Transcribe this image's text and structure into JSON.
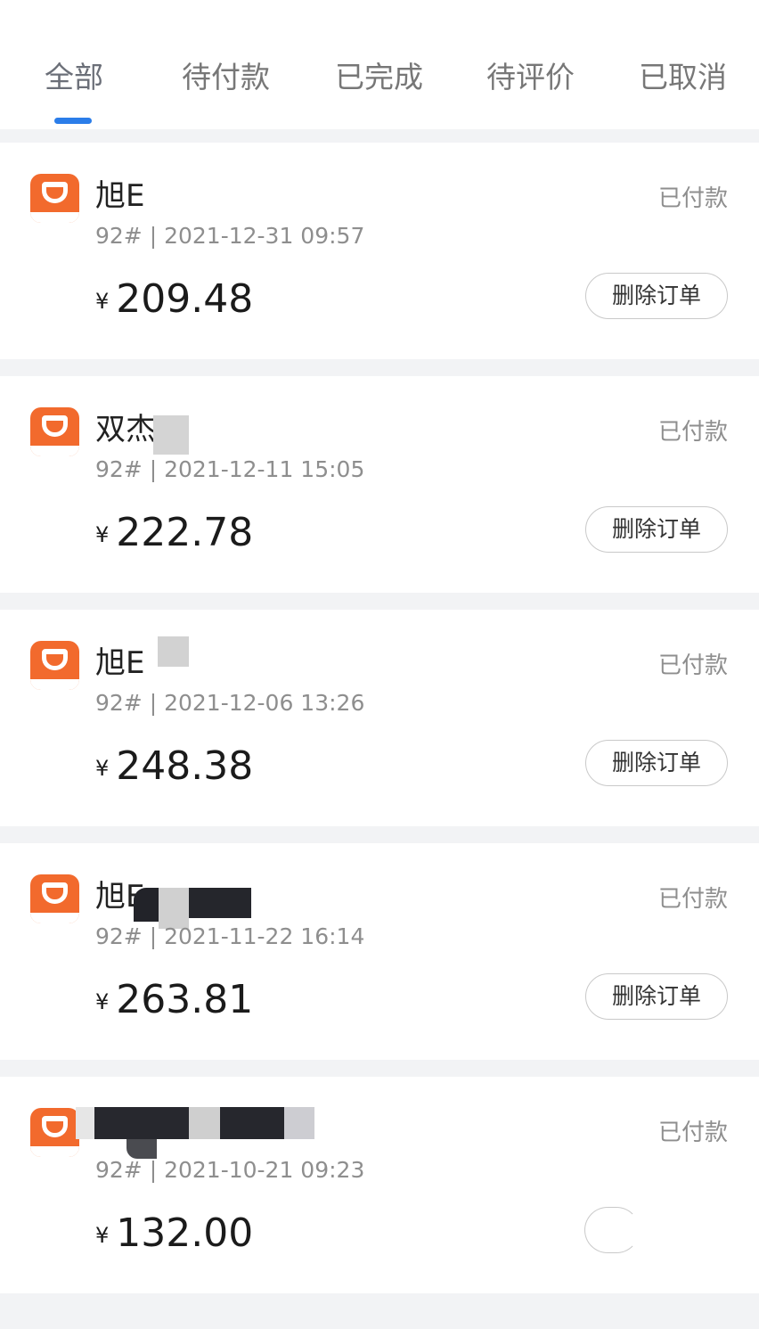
{
  "tabs": [
    "全部",
    "待付款",
    "已完成",
    "待评价",
    "已取消"
  ],
  "active_tab": "全部",
  "orders": [
    {
      "merchant": "旭E",
      "meta": "92# | 2021-12-31 09:57",
      "status": "已付款",
      "currency": "¥",
      "amount": "209.48",
      "action": "删除订单"
    },
    {
      "merchant": "双杰",
      "meta": "92# | 2021-12-11 15:05",
      "status": "已付款",
      "currency": "¥",
      "amount": "222.78",
      "action": "删除订单"
    },
    {
      "merchant": "旭E",
      "meta": "92# | 2021-12-06 13:26",
      "status": "已付款",
      "currency": "¥",
      "amount": "248.38",
      "action": "删除订单"
    },
    {
      "merchant": "旭E",
      "meta": "92# | 2021-11-22 16:14",
      "status": "已付款",
      "currency": "¥",
      "amount": "263.81",
      "action": "删除订单"
    },
    {
      "merchant": "",
      "meta": "92# | 2021-10-21 09:23",
      "status": "已付款",
      "currency": "¥",
      "amount": "132.00",
      "action": ""
    }
  ],
  "colors": {
    "accent": "#2b7de9",
    "app_icon": "#f26a2d",
    "background": "#f2f3f5"
  },
  "icons": {
    "app": "didi-refuel-app-icon"
  }
}
